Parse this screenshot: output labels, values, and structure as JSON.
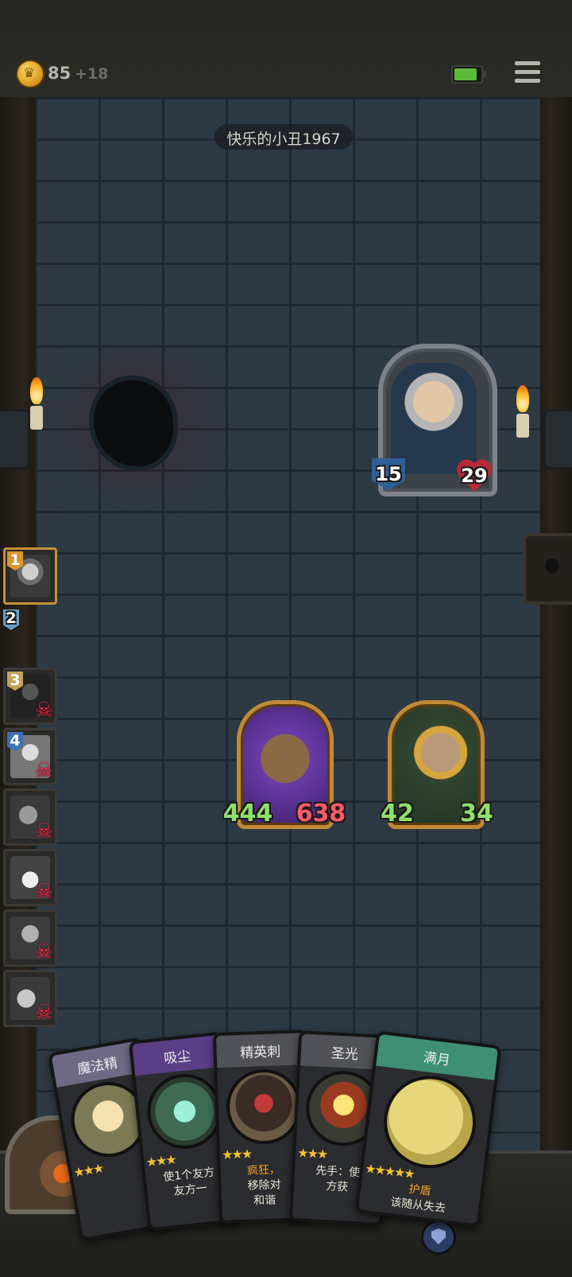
{
  "hud": {
    "gold": "85",
    "gold_income": "+18",
    "battery_color": "#5dbb3a"
  },
  "opponent": {
    "name": "快乐的小丑1967",
    "hero_attack": "15",
    "hero_health": "29"
  },
  "board": {
    "enemy_minions": [
      {
        "attack": "444",
        "health": "638"
      },
      {
        "attack": "42",
        "health": "34"
      }
    ]
  },
  "queue": [
    {
      "rank": "1",
      "status": "current"
    },
    {
      "rank": "2",
      "status": "empty"
    },
    {
      "rank": "3",
      "status": "dead"
    },
    {
      "rank": "4",
      "status": "dead"
    },
    {
      "rank": "",
      "status": "dead"
    },
    {
      "rank": "",
      "status": "dead"
    },
    {
      "rank": "",
      "status": "dead"
    },
    {
      "rank": "",
      "status": "dead"
    }
  ],
  "hand": [
    {
      "title": "魔法精",
      "stars": "★★★",
      "text": "",
      "color": "#6e6a86"
    },
    {
      "title": "吸尘",
      "stars": "★★★",
      "text1": "使1个友方",
      "text2": "友方一",
      "color": "#5a3f87"
    },
    {
      "title": "精英刺",
      "stars": "★★★",
      "text1": "疯狂，",
      "text2": "移除对",
      "text3": "和谐",
      "color": "#505257"
    },
    {
      "title": "圣光",
      "stars": "★★★",
      "text1": "先手：使",
      "text2": "方获",
      "color": "#505257"
    },
    {
      "title": "满月",
      "stars": "★★★★★",
      "text1": "护盾",
      "text2": "该随从失去",
      "color": "#3e8f74"
    }
  ],
  "colors": {
    "skull": "#ff2a49",
    "friendly_stat": "#8fe06a",
    "enemy_health": "#ff5a6a",
    "attack_badge": "#2f5f96",
    "health_badge": "#b52a37"
  }
}
